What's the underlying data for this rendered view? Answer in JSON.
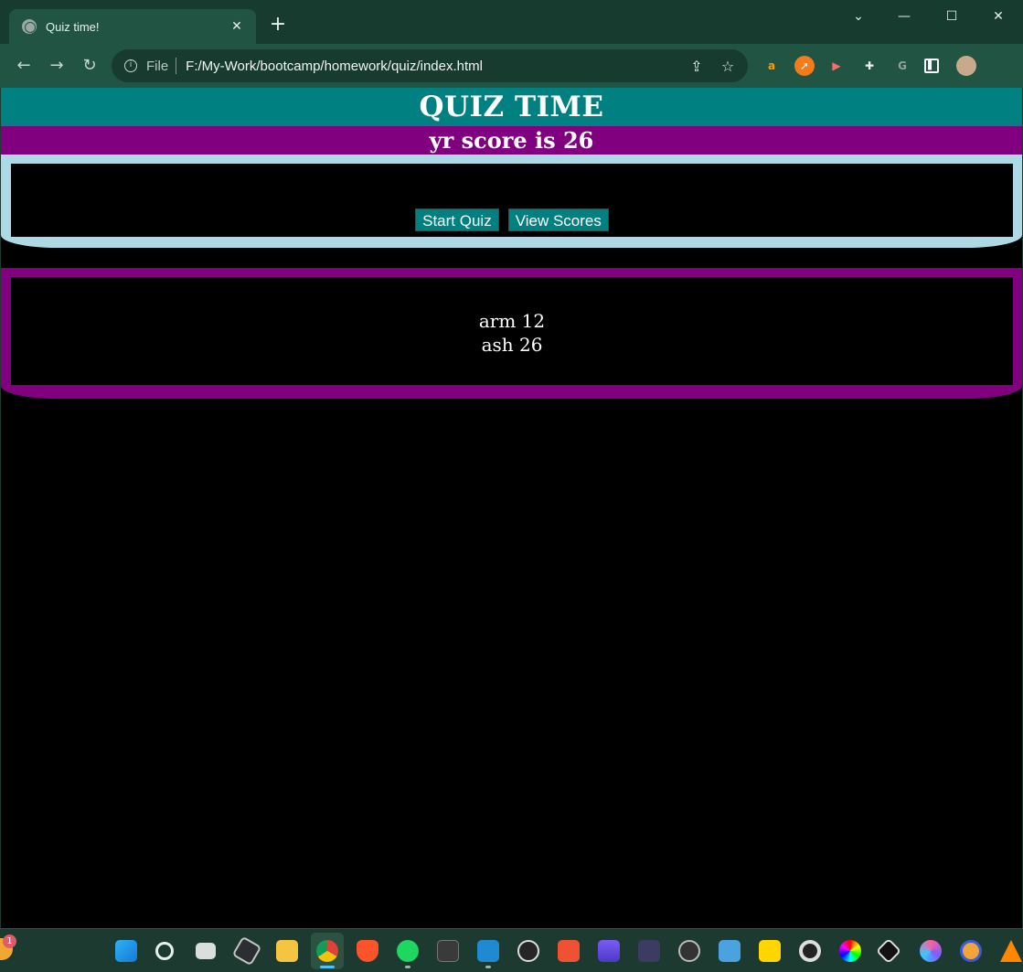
{
  "browser": {
    "tab_title": "Quiz time!",
    "tab_close": "✕",
    "new_tab": "+",
    "window_controls": {
      "minimize": "—",
      "maximize": "☐",
      "close": "✕",
      "tab_search": "⌄"
    },
    "nav": {
      "back": "←",
      "forward": "→",
      "reload": "↻"
    },
    "address": {
      "scheme": "File",
      "url": "F:/My-Work/bootcamp/homework/quiz/index.html"
    },
    "extensions": [
      "amazon-icon",
      "ask-icon",
      "video-icon",
      "puzzle-icon",
      "google-icon",
      "sidebar-icon",
      "profile-avatar"
    ]
  },
  "page": {
    "title": "QUIZ TIME",
    "score_message": "yr score is 26",
    "buttons": {
      "start": "Start Quiz",
      "view_scores": "View Scores"
    },
    "high_scores": [
      "arm 12",
      "ash 26"
    ]
  },
  "colors": {
    "header_bg": "#008080",
    "score_bar_bg": "#800080",
    "controls_frame": "#add8e6",
    "scores_frame": "#800080",
    "page_bg": "#000000",
    "button_bg": "#008080"
  },
  "taskbar": {
    "notification_badge": "1",
    "icons": [
      "windows-start-icon",
      "search-icon",
      "task-view-icon",
      "unity-icon",
      "file-explorer-icon",
      "chrome-icon",
      "brave-icon",
      "spotify-icon",
      "terminal-icon",
      "vscode-icon",
      "obs-icon",
      "git-icon",
      "clapper-icon",
      "app-icon",
      "steam-icon",
      "notepad-icon",
      "sticky-notes-icon",
      "davinci-icon",
      "color-icon",
      "inkscape-icon",
      "paint-icon",
      "headset-icon",
      "vlc-icon"
    ]
  }
}
